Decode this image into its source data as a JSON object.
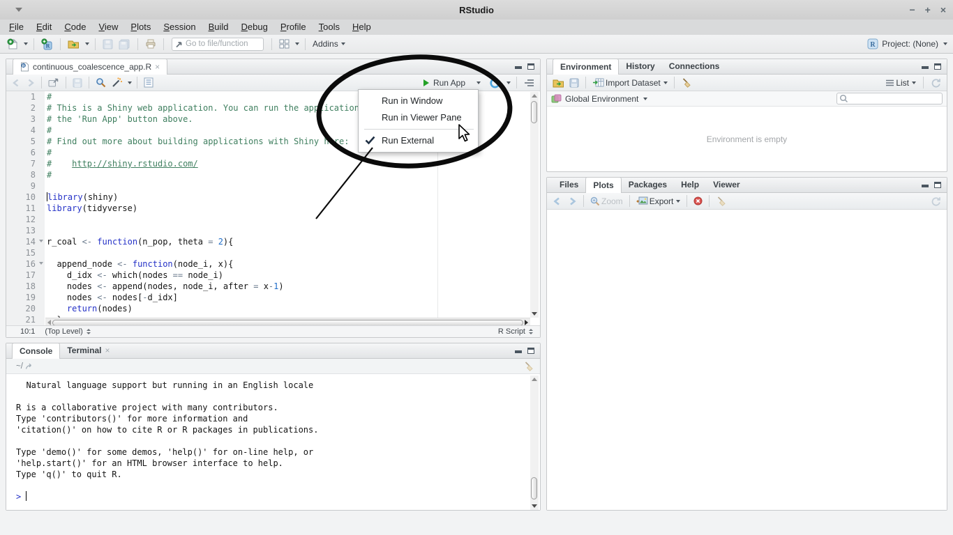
{
  "window": {
    "title": "RStudio",
    "minimize": "−",
    "maximize": "+",
    "close": "×"
  },
  "menu_bar": {
    "items": [
      "File",
      "Edit",
      "Code",
      "View",
      "Plots",
      "Session",
      "Build",
      "Debug",
      "Profile",
      "Tools",
      "Help"
    ]
  },
  "main_toolbar": {
    "goto_placeholder": "Go to file/function",
    "addins_label": "Addins",
    "project_label": "Project: (None)"
  },
  "editor": {
    "tab_title": "continuous_coalescence_app.R",
    "run_app_label": "Run App",
    "fold_lines": [
      14,
      16
    ],
    "cursor_line": 10,
    "lines": [
      {
        "n": 1,
        "s": [
          [
            "c",
            "#"
          ]
        ]
      },
      {
        "n": 2,
        "s": [
          [
            "c",
            "# This is a Shiny web application. You can run the application by clicking"
          ]
        ]
      },
      {
        "n": 3,
        "s": [
          [
            "c",
            "# the 'Run App' button above."
          ]
        ]
      },
      {
        "n": 4,
        "s": [
          [
            "c",
            "#"
          ]
        ]
      },
      {
        "n": 5,
        "s": [
          [
            "c",
            "# Find out more about building applications with Shiny here:"
          ]
        ]
      },
      {
        "n": 6,
        "s": [
          [
            "c",
            "#"
          ]
        ]
      },
      {
        "n": 7,
        "s": [
          [
            "c",
            "#    "
          ],
          [
            "l",
            "http://shiny.rstudio.com/"
          ]
        ]
      },
      {
        "n": 8,
        "s": [
          [
            "c",
            "#"
          ]
        ]
      },
      {
        "n": 9,
        "s": []
      },
      {
        "n": 10,
        "s": [
          [
            "k",
            "library"
          ],
          [
            "p",
            "("
          ],
          [
            "t",
            "shiny"
          ],
          [
            "p",
            ")"
          ]
        ]
      },
      {
        "n": 11,
        "s": [
          [
            "k",
            "library"
          ],
          [
            "p",
            "("
          ],
          [
            "t",
            "tidyverse"
          ],
          [
            "p",
            ")"
          ]
        ]
      },
      {
        "n": 12,
        "s": []
      },
      {
        "n": 13,
        "s": []
      },
      {
        "n": 14,
        "s": [
          [
            "t",
            "r_coal "
          ],
          [
            "o",
            "<-"
          ],
          [
            "t",
            " "
          ],
          [
            "k",
            "function"
          ],
          [
            "p",
            "("
          ],
          [
            "t",
            "n_pop, theta "
          ],
          [
            "o",
            "="
          ],
          [
            "t",
            " "
          ],
          [
            "n",
            "2"
          ],
          [
            "p",
            "){"
          ]
        ]
      },
      {
        "n": 15,
        "s": []
      },
      {
        "n": 16,
        "s": [
          [
            "t",
            "  append_node "
          ],
          [
            "o",
            "<-"
          ],
          [
            "t",
            " "
          ],
          [
            "k",
            "function"
          ],
          [
            "p",
            "("
          ],
          [
            "t",
            "node_i, x"
          ],
          [
            "p",
            "){"
          ]
        ]
      },
      {
        "n": 17,
        "s": [
          [
            "t",
            "    d_idx "
          ],
          [
            "o",
            "<-"
          ],
          [
            "t",
            " which"
          ],
          [
            "p",
            "("
          ],
          [
            "t",
            "nodes "
          ],
          [
            "o",
            "=="
          ],
          [
            "t",
            " node_i"
          ],
          [
            "p",
            ")"
          ]
        ]
      },
      {
        "n": 18,
        "s": [
          [
            "t",
            "    nodes "
          ],
          [
            "o",
            "<-"
          ],
          [
            "t",
            " append"
          ],
          [
            "p",
            "("
          ],
          [
            "t",
            "nodes, node_i, after "
          ],
          [
            "o",
            "="
          ],
          [
            "t",
            " x"
          ],
          [
            "o",
            "-"
          ],
          [
            "n",
            "1"
          ],
          [
            "p",
            ")"
          ]
        ]
      },
      {
        "n": 19,
        "s": [
          [
            "t",
            "    nodes "
          ],
          [
            "o",
            "<-"
          ],
          [
            "t",
            " nodes"
          ],
          [
            "p",
            "["
          ],
          [
            "o",
            "-"
          ],
          [
            "t",
            "d_idx"
          ],
          [
            "p",
            "]"
          ]
        ]
      },
      {
        "n": 20,
        "s": [
          [
            "t",
            "    "
          ],
          [
            "k",
            "return"
          ],
          [
            "p",
            "("
          ],
          [
            "t",
            "nodes"
          ],
          [
            "p",
            ")"
          ]
        ]
      },
      {
        "n": 21,
        "s": [
          [
            "p",
            "  }"
          ]
        ]
      }
    ],
    "status": {
      "position": "10:1",
      "scope": "(Top Level)",
      "language": "R Script"
    }
  },
  "run_menu": {
    "items": [
      {
        "label": "Run in Window",
        "checked": false
      },
      {
        "label": "Run in Viewer Pane",
        "checked": false
      },
      {
        "label": "Run External",
        "checked": true
      }
    ],
    "separator_after": 1
  },
  "console": {
    "tabs": [
      "Console",
      "Terminal"
    ],
    "path": "~/",
    "lines": [
      "  Natural language support but running in an English locale",
      "",
      "R is a collaborative project with many contributors.",
      "Type 'contributors()' for more information and",
      "'citation()' on how to cite R or R packages in publications.",
      "",
      "Type 'demo()' for some demos, 'help()' for on-line help, or",
      "'help.start()' for an HTML browser interface to help.",
      "Type 'q()' to quit R.",
      ""
    ],
    "prompt": ">"
  },
  "env_pane": {
    "tabs": [
      "Environment",
      "History",
      "Connections"
    ],
    "import_label": "Import Dataset",
    "list_label": "List",
    "scope_label": "Global Environment",
    "empty_message": "Environment is empty"
  },
  "plots_pane": {
    "tabs": [
      "Files",
      "Plots",
      "Packages",
      "Help",
      "Viewer"
    ],
    "zoom_label": "Zoom",
    "export_label": "Export"
  },
  "colors": {
    "comment": "#3f7f5f",
    "keyword": "#2431c7",
    "number": "#1d6cc9",
    "run_green": "#23a127",
    "publish_blue": "#4aa3dd",
    "annotation": "#0b0b0b",
    "prompt_blue": "#2431c7"
  },
  "icons": {
    "window-menu": "triangle-down",
    "new-file": "page-plus",
    "new-project": "r-cube-plus",
    "open-file": "folder-arrow",
    "save": "floppy",
    "save-all": "double-floppy",
    "print": "printer",
    "goto": "arrow-up-right",
    "pane-layout": "grid",
    "project": "r-badge",
    "back": "chevron-left",
    "forward": "chevron-right",
    "popout": "window-arrow",
    "find": "magnifier",
    "code-tools": "magic-wand",
    "compile-report": "notebook",
    "run": "play-triangle",
    "publish": "blue-circle-arrow",
    "document-outline": "outline-lines",
    "import-dataset": "table-arrow",
    "clear": "broom",
    "list-view": "hamburger",
    "refresh": "circular-arrow",
    "search": "magnifier",
    "zoom-plot": "magnifier",
    "export-plot": "image",
    "remove-plot": "red-circle-x",
    "check": "checkmark",
    "prompt-redirect": "curved-arrow",
    "cursor": "arrow-pointer"
  }
}
